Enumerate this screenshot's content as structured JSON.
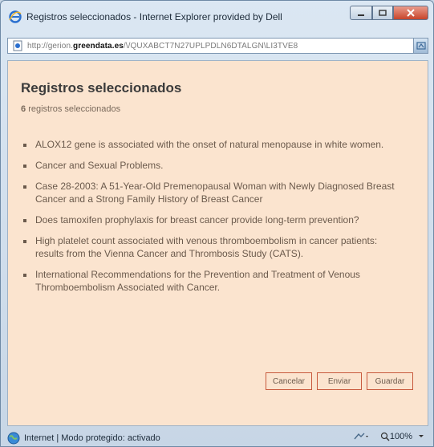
{
  "window": {
    "title": "Registros seleccionados - Internet Explorer provided by Dell"
  },
  "address": {
    "prefix": "http://gerion.",
    "domain": "greendata.es",
    "rest": "/\\/QUXABCT7N27UPLPDLN6DTALGN\\LI3TVE8"
  },
  "page": {
    "heading": "Registros seleccionados",
    "count_number": "6",
    "count_label": "registros seleccionados",
    "records": [
      "ALOX12 gene is associated with the onset of natural menopause in white women.",
      "Cancer and Sexual Problems.",
      "Case 28-2003: A 51-Year-Old Premenopausal Woman with Newly Diagnosed Breast Cancer and a Strong Family History of Breast Cancer",
      "Does tamoxifen prophylaxis for breast cancer provide long-term prevention?",
      "High platelet count associated with venous thromboembolism in cancer patients: results from the Vienna Cancer and Thrombosis Study (CATS).",
      "International Recommendations for the Prevention and Treatment of Venous Thromboembolism Associated with Cancer."
    ],
    "buttons": {
      "cancel": "Cancelar",
      "send": "Enviar",
      "save": "Guardar"
    }
  },
  "status": {
    "zone": "Internet | Modo protegido: activado",
    "zoom": "100%"
  },
  "colors": {
    "content_bg": "#fbe4cf",
    "button_border": "#c85a3e",
    "text": "#6b5a4c"
  }
}
